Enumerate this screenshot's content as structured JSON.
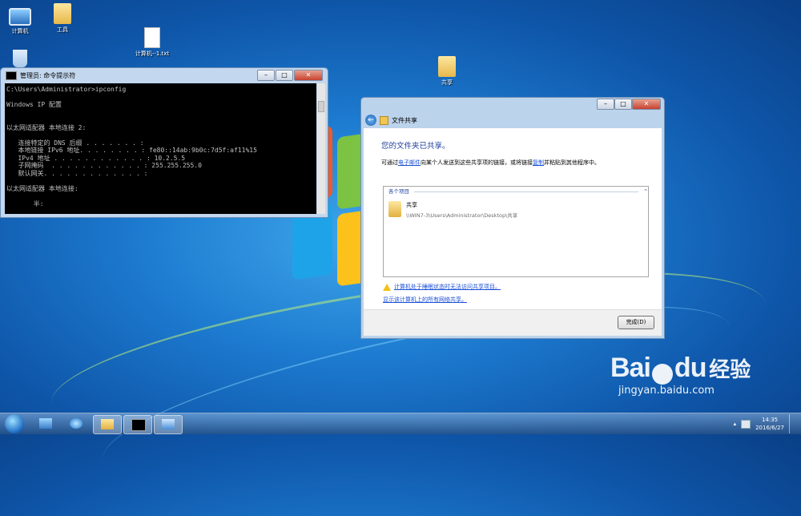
{
  "desktop": {
    "icons": [
      {
        "label": "计算机"
      },
      {
        "label": "工具"
      },
      {
        "label": "计算机--1.txt"
      },
      {
        "label": "共享"
      }
    ]
  },
  "cmd_window": {
    "title": "管理员: 命令提示符",
    "lines": [
      "C:\\Users\\Administrator>ipconfig",
      "",
      "Windows IP 配置",
      "",
      "",
      "以太网适配器 本地连接 2:",
      "",
      "   连接特定的 DNS 后缀 . . . . . . . :",
      "   本地链接 IPv6 地址. . . . . . . . : fe80::14ab:9b0c:7d5f:af11%15",
      "   IPv4 地址 . . . . . . . . . . . . : 10.2.5.5",
      "   子网掩码  . . . . . . . . . . . . : 255.255.255.0",
      "   默认网关. . . . . . . . . . . . . :",
      "",
      "以太网适配器 本地连接:",
      "",
      "       半:"
    ]
  },
  "share_dialog": {
    "title": "文件共享",
    "heading": "您的文件夹已共享。",
    "desc_prefix": "可通过",
    "desc_link_email": "电子邮件",
    "desc_middle": "向某个人发送到这些共享项的链接，或将链接",
    "desc_link_copy": "复制",
    "desc_suffix": "并粘贴到其他程序中。",
    "list_header": "各个项目",
    "item_name": "共享",
    "item_path": "\\\\WIN7-3\\Users\\Administrator\\Desktop\\共享",
    "warning_link": "计算机处于睡眠状态时无法访问共享项目。",
    "show_all_link": "显示该计算机上的所有网络共享。",
    "done_button": "完成(D)"
  },
  "watermark": {
    "brand": "Bai",
    "brand2": "du",
    "jingyan": "经验",
    "url": "jingyan.baidu.com"
  },
  "taskbar": {
    "time": "14:35",
    "date": "2016/6/27"
  },
  "colors": {
    "link": "#1a4fd6",
    "heading": "#1e3f9c"
  }
}
